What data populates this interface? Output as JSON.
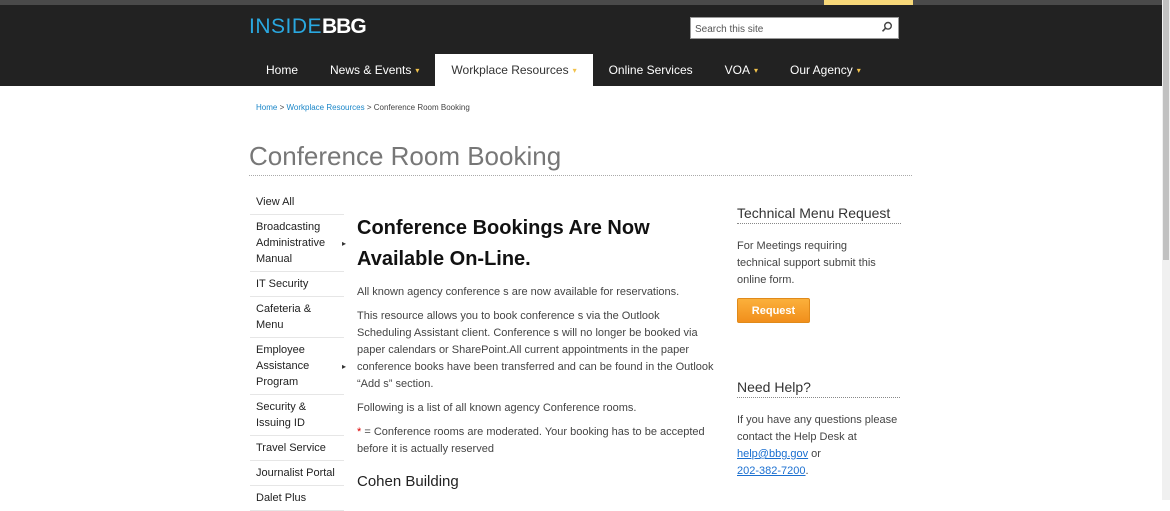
{
  "header": {
    "logo_inside": "INSIDE",
    "logo_bbg": "BBG",
    "search_placeholder": "Search this site"
  },
  "nav": {
    "items": [
      {
        "label": "Home",
        "has_dropdown": false
      },
      {
        "label": "News & Events",
        "has_dropdown": true
      },
      {
        "label": "Workplace Resources",
        "has_dropdown": true,
        "active": true
      },
      {
        "label": "Online Services",
        "has_dropdown": false
      },
      {
        "label": "VOA",
        "has_dropdown": true
      },
      {
        "label": "Our Agency",
        "has_dropdown": true
      }
    ],
    "dropdown_glyph": "▾"
  },
  "breadcrumb": {
    "home": "Home",
    "sep": ">",
    "section": "Workplace Resources",
    "current": "Conference Room Booking"
  },
  "page_title": "Conference Room Booking",
  "sidebar": {
    "items": [
      {
        "label": "View All",
        "has_submenu": false
      },
      {
        "label": "Broadcasting Administrative Manual",
        "has_submenu": true
      },
      {
        "label": "IT Security",
        "has_submenu": false
      },
      {
        "label": "Cafeteria & Menu",
        "has_submenu": false
      },
      {
        "label": "Employee Assistance Program",
        "has_submenu": true
      },
      {
        "label": "Security & Issuing ID",
        "has_submenu": false
      },
      {
        "label": "Travel Service",
        "has_submenu": false
      },
      {
        "label": "Journalist Portal",
        "has_submenu": false
      },
      {
        "label": "Dalet Plus",
        "has_submenu": false
      }
    ],
    "submenu_glyph": "▸"
  },
  "main": {
    "heading": "Conference Bookings Are Now Available On-Line.",
    "p1": "All known agency conference s are now available for reservations.",
    "p2": "This resource allows you to book conference s via the Outlook Scheduling Assistant client. Conference s will no longer be booked via paper calendars or SharePoint.All current appointments in the paper conference books have been transferred and can be found in the Outlook “Add s” section.",
    "p3": "Following is a list of all known agency Conference rooms.",
    "p4_star": "*",
    "p4": " = Conference rooms are moderated. Your booking has to be accepted before it is actually reserved",
    "subheading": "Cohen Building"
  },
  "right": {
    "tech_title": "Technical Menu Request",
    "tech_text": "For Meetings requiring technical support submit this online form.",
    "request_button": "Request",
    "help_title": "Need Help?",
    "help_text": "If you have any questions please contact the Help Desk at",
    "help_email": "help@bbg.gov",
    "help_or": " or",
    "help_phone": "202-382-7200",
    "help_end": "."
  },
  "colors": {
    "header_bg": "#222222",
    "logo_blue": "#2aa8e0",
    "link": "#1a86c8",
    "button_orange": "#f7a12a",
    "nav_arrow": "#f2c24b"
  }
}
